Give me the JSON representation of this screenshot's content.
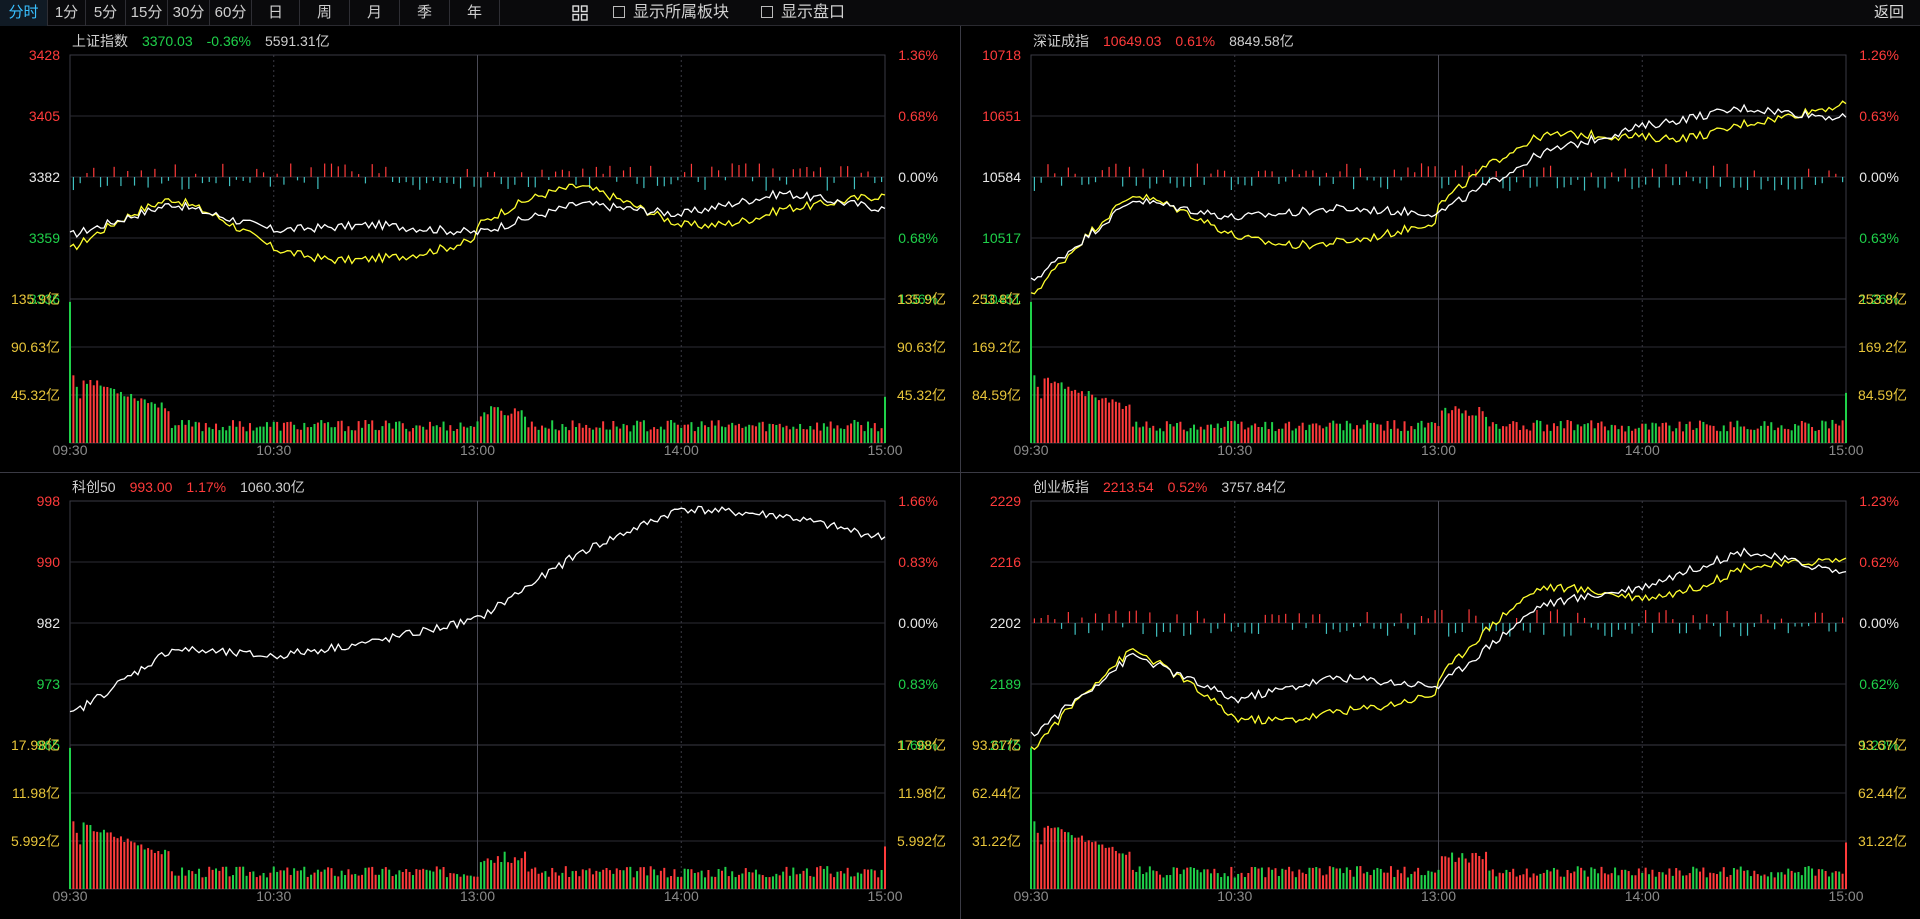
{
  "toolbar": {
    "buttons": [
      "分时",
      "1分",
      "5分",
      "15分",
      "30分",
      "60分",
      "日",
      "周",
      "月",
      "季",
      "年"
    ],
    "active": "分时",
    "checkbox1": "显示所属板块",
    "checkbox2": "显示盘口",
    "back": "返回"
  },
  "colors": {
    "up": "#ff3b3b",
    "down": "#1fd14a",
    "flat": "#e8e8e8",
    "price_line": "#ffffff",
    "avg_line": "#ffff2e",
    "volume_label": "#e8c53a",
    "grid": "#2b2b33",
    "bar_down": "#3fbfbf"
  },
  "time_labels": [
    "09:30",
    "10:30",
    "13:00",
    "14:00",
    "15:00"
  ],
  "panels": [
    {
      "name": "上证指数",
      "price": "3370.03",
      "change": "-0.36%",
      "amount": "5591.31亿",
      "price_color": "down",
      "change_color": "down",
      "y_labels": [
        "3428",
        "3405",
        "3382",
        "3359",
        "3336"
      ],
      "pct_labels": [
        "1.36%",
        "0.68%",
        "0.00%",
        "0.68%",
        "1.36%"
      ],
      "vol_labels": [
        "135.9亿",
        "90.63亿",
        "45.32亿"
      ],
      "show_avg": true,
      "chart_data": {
        "type": "line",
        "x": [
          "09:30",
          "10:00",
          "10:30",
          "11:00",
          "11:30/13:00",
          "13:30",
          "14:00",
          "14:30",
          "15:00"
        ],
        "series": [
          {
            "values": [
              3360,
              3372,
              3362,
              3364,
              3361,
              3372,
              3368,
              3376,
              3370
            ]
          }
        ],
        "ylim": [
          3336,
          3428
        ]
      }
    },
    {
      "name": "深证成指",
      "price": "10649.03",
      "change": "0.61%",
      "amount": "8849.58亿",
      "price_color": "up",
      "change_color": "up",
      "y_labels": [
        "10718",
        "10651",
        "10584",
        "10517",
        "10451"
      ],
      "pct_labels": [
        "1.26%",
        "0.63%",
        "0.00%",
        "0.63%",
        "1.26%"
      ],
      "vol_labels": [
        "253.8亿",
        "169.2亿",
        "84.59亿"
      ],
      "show_avg": true,
      "chart_data": {
        "type": "line",
        "x": [
          "09:30",
          "10:00",
          "10:30",
          "11:00",
          "11:30/13:00",
          "13:30",
          "14:00",
          "14:30",
          "15:00"
        ],
        "series": [
          {
            "values": [
              10470,
              10560,
              10540,
              10550,
              10545,
              10610,
              10640,
              10660,
              10649
            ]
          }
        ],
        "ylim": [
          10451,
          10718
        ]
      }
    },
    {
      "name": "科创50",
      "price": "993.00",
      "change": "1.17%",
      "amount": "1060.30亿",
      "price_color": "up",
      "change_color": "up",
      "y_labels": [
        "998",
        "990",
        "982",
        "973",
        "965"
      ],
      "pct_labels": [
        "1.66%",
        "0.83%",
        "0.00%",
        "0.83%",
        "1.66%"
      ],
      "vol_labels": [
        "17.98亿",
        "11.98亿",
        "5.992亿"
      ],
      "show_avg": false,
      "chart_data": {
        "type": "line",
        "x": [
          "09:30",
          "10:00",
          "10:30",
          "11:00",
          "11:30/13:00",
          "13:30",
          "14:00",
          "14:30",
          "15:00"
        ],
        "series": [
          {
            "values": [
              969,
              978,
              977,
              979,
              982,
              991,
              997,
              996,
              993
            ]
          }
        ],
        "ylim": [
          965,
          998
        ]
      }
    },
    {
      "name": "创业板指",
      "price": "2213.54",
      "change": "0.52%",
      "amount": "3757.84亿",
      "price_color": "up",
      "change_color": "up",
      "y_labels": [
        "2229",
        "2216",
        "2202",
        "2189",
        "2175"
      ],
      "pct_labels": [
        "1.23%",
        "0.62%",
        "0.00%",
        "0.62%",
        "1.23%"
      ],
      "vol_labels": [
        "93.67亿",
        "62.44亿",
        "31.22亿"
      ],
      "show_avg": true,
      "chart_data": {
        "type": "line",
        "x": [
          "09:30",
          "10:00",
          "10:30",
          "11:00",
          "11:30/13:00",
          "13:30",
          "14:00",
          "14:30",
          "15:00"
        ],
        "series": [
          {
            "values": [
              2177,
              2195,
              2185,
              2190,
              2188,
              2206,
              2210,
              2218,
              2213
            ]
          }
        ],
        "ylim": [
          2175,
          2229
        ]
      }
    }
  ]
}
